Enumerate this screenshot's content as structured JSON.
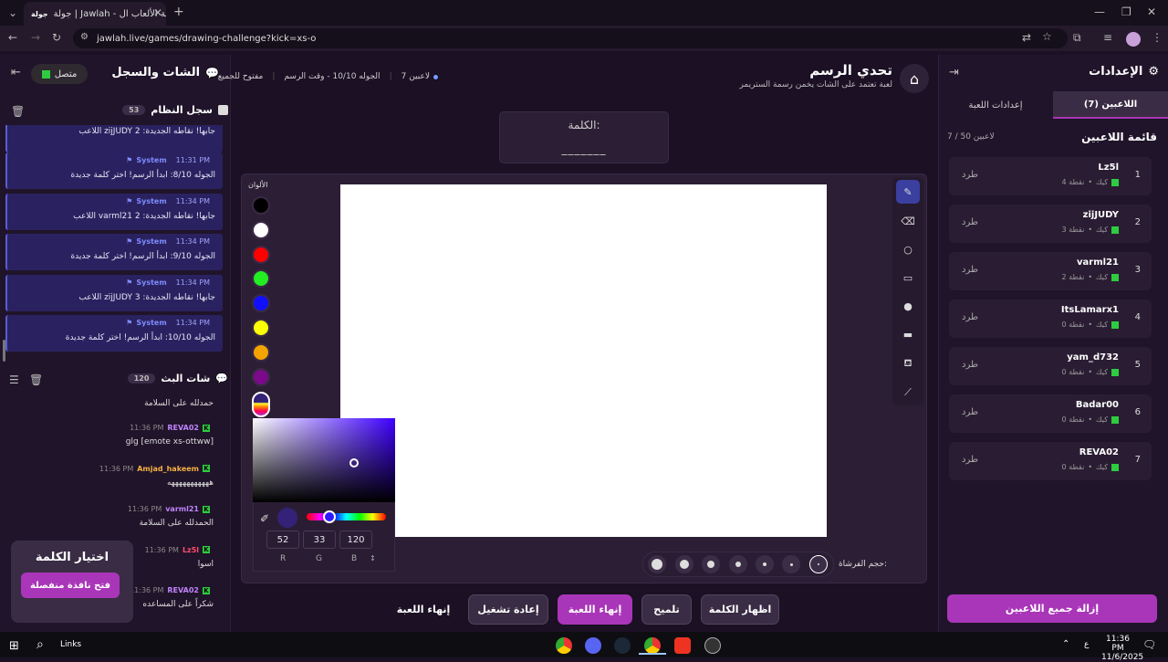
{
  "browser": {
    "tab_title": "جولة | Jawlah - منصة الألعاب ال...",
    "url": "jawlah.live/games/drawing-challenge?kick=xs-o"
  },
  "left_panel": {
    "title": "الشات والسجل",
    "status": "متصل",
    "log_title": "سجل النظام",
    "log_count": "53",
    "log_messages": [
      {
        "text": "اللاعب zijJUDY جابها! نقاطه الجديدة: 2",
        "partial": true
      },
      {
        "sender": "System",
        "time": "11:31 PM",
        "text": "الجوله 8/10: ابدأ الرسم! اختر كلمة جديدة"
      },
      {
        "sender": "System",
        "time": "11:34 PM",
        "text": "اللاعب varml21 جابها! نقاطه الجديدة: 2"
      },
      {
        "sender": "System",
        "time": "11:34 PM",
        "text": "الجوله 9/10: ابدأ الرسم! اختر كلمة جديدة"
      },
      {
        "sender": "System",
        "time": "11:34 PM",
        "text": "اللاعب zijJUDY جابها! نقاطه الجديدة: 3"
      },
      {
        "sender": "System",
        "time": "11:34 PM",
        "text": "الجوله 10/10: ابدأ الرسم! اختر كلمة جديدة"
      }
    ],
    "chat_title": "شات البث",
    "chat_count": "120",
    "chat_messages": [
      {
        "user": "",
        "time": "",
        "text": "حمدلله على السلامة",
        "color": "#ddd"
      },
      {
        "user": "REVA02",
        "time": "11:36 PM",
        "text": "glg [emote xs-ottww]",
        "color": "#c084fc"
      },
      {
        "user": "Amjad_hakeem",
        "time": "11:36 PM",
        "text": "هههههههههههه",
        "color": "#f5b041"
      },
      {
        "user": "varml21",
        "time": "11:36 PM",
        "text": "الحمدلله على السلامة",
        "color": "#c084fc"
      },
      {
        "user": "Lz5l",
        "time": "11:36 PM",
        "text": "اسوا",
        "color": "#ff4d6d"
      },
      {
        "user": "REVA02",
        "time": "11:36 PM",
        "text": "شكراً على المساعده",
        "color": "#c084fc"
      }
    ],
    "word_choice": {
      "title": "اختيار الكلمة",
      "button": "فتح نافذة منفصلة"
    }
  },
  "header": {
    "title": "تحدي الرسم",
    "subtitle": "لعبة تعتمد على الشات يخمن رسمة الستريمر",
    "players": "7 لاعبين",
    "round": "الجوله 10/10 - وقت الرسم",
    "open": "مفتوح للجميع"
  },
  "word_box": {
    "label": "الكلمة:",
    "blank": "_______"
  },
  "palette": {
    "title": "الألوان",
    "colors": [
      "#000000",
      "#ffffff",
      "#ff0000",
      "#22ee22",
      "#1010ff",
      "#ffff00",
      "#f5a300",
      "#7a0a8a"
    ]
  },
  "color_picker": {
    "r": "52",
    "g": "33",
    "b": "120",
    "r_label": "R",
    "g_label": "G",
    "b_label": "B",
    "current": "#342178"
  },
  "brush_label": "حجم الفرشاة:",
  "bottom_buttons": {
    "show_word": "اظهار الكلمة",
    "hint": "تلميح",
    "end_round": "إنهاء اللعبة",
    "restart": "إعادة تشغيل",
    "end_game": "إنهاء اللعبة"
  },
  "right_panel": {
    "title": "الإعدادات",
    "tab_players": "اللاعبين (7)",
    "tab_settings": "إعدادات اللعبة",
    "list_title": "قائمة اللاعبين",
    "list_count": "7 / 50 لاعبين",
    "kick_label": "طرد",
    "platform": "كيك",
    "players": [
      {
        "num": "1",
        "name": "Lz5l",
        "points": "4 نقطة"
      },
      {
        "num": "2",
        "name": "zijJUDY",
        "points": "3 نقطة"
      },
      {
        "num": "3",
        "name": "varml21",
        "points": "2 نقطة"
      },
      {
        "num": "4",
        "name": "ItsLamarx1",
        "points": "0 نقطة"
      },
      {
        "num": "5",
        "name": "yam_d732",
        "points": "0 نقطة"
      },
      {
        "num": "6",
        "name": "Badar00",
        "points": "0 نقطة"
      },
      {
        "num": "7",
        "name": "REVA02",
        "points": "0 نقطة"
      }
    ],
    "remove_all": "إزالة جميع اللاعبين"
  },
  "taskbar": {
    "search": "Links",
    "time": "11:36 PM",
    "date": "11/6/2025",
    "lang": "ع"
  }
}
